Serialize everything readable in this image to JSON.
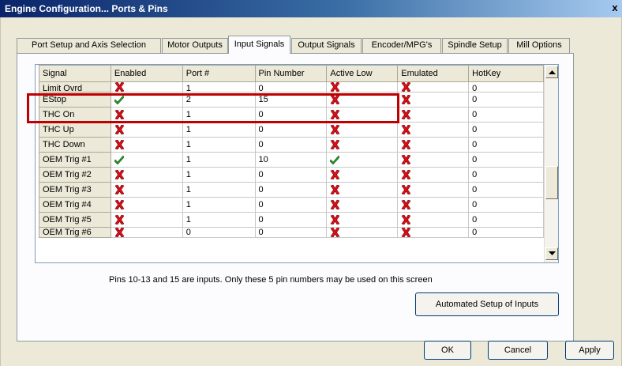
{
  "window": {
    "title": "Engine Configuration... Ports & Pins",
    "close_label": "x"
  },
  "tabs": [
    {
      "label": "Port Setup and Axis Selection",
      "active": false
    },
    {
      "label": "Motor Outputs",
      "active": false
    },
    {
      "label": "Input Signals",
      "active": true
    },
    {
      "label": "Output Signals",
      "active": false
    },
    {
      "label": "Encoder/MPG's",
      "active": false
    },
    {
      "label": "Spindle Setup",
      "active": false
    },
    {
      "label": "Mill Options",
      "active": false
    }
  ],
  "grid": {
    "columns": [
      "Signal",
      "Enabled",
      "Port #",
      "Pin Number",
      "Active Low",
      "Emulated",
      "HotKey"
    ],
    "rows": [
      {
        "signal": "Limit Ovrd",
        "enabled": "cross",
        "port": "1",
        "pin": "0",
        "active_low": "cross",
        "emulated": "cross",
        "hotkey": "0"
      },
      {
        "signal": "EStop",
        "enabled": "check",
        "port": "2",
        "pin": "15",
        "active_low": "cross",
        "emulated": "cross",
        "hotkey": "0"
      },
      {
        "signal": "THC On",
        "enabled": "cross",
        "port": "1",
        "pin": "0",
        "active_low": "cross",
        "emulated": "cross",
        "hotkey": "0"
      },
      {
        "signal": "THC Up",
        "enabled": "cross",
        "port": "1",
        "pin": "0",
        "active_low": "cross",
        "emulated": "cross",
        "hotkey": "0"
      },
      {
        "signal": "THC Down",
        "enabled": "cross",
        "port": "1",
        "pin": "0",
        "active_low": "cross",
        "emulated": "cross",
        "hotkey": "0"
      },
      {
        "signal": "OEM Trig #1",
        "enabled": "check",
        "port": "1",
        "pin": "10",
        "active_low": "check",
        "emulated": "cross",
        "hotkey": "0"
      },
      {
        "signal": "OEM Trig #2",
        "enabled": "cross",
        "port": "1",
        "pin": "0",
        "active_low": "cross",
        "emulated": "cross",
        "hotkey": "0"
      },
      {
        "signal": "OEM Trig #3",
        "enabled": "cross",
        "port": "1",
        "pin": "0",
        "active_low": "cross",
        "emulated": "cross",
        "hotkey": "0"
      },
      {
        "signal": "OEM Trig #4",
        "enabled": "cross",
        "port": "1",
        "pin": "0",
        "active_low": "cross",
        "emulated": "cross",
        "hotkey": "0"
      },
      {
        "signal": "OEM Trig #5",
        "enabled": "cross",
        "port": "1",
        "pin": "0",
        "active_low": "cross",
        "emulated": "cross",
        "hotkey": "0"
      },
      {
        "signal": "OEM Trig #6",
        "enabled": "cross",
        "port": "0",
        "pin": "0",
        "active_low": "cross",
        "emulated": "cross",
        "hotkey": "0"
      }
    ]
  },
  "icons": {
    "cross": "red-x-icon",
    "check": "green-check-icon"
  },
  "colors": {
    "cross": "#d8101a",
    "check": "#2e9a2e",
    "highlight": "#c00000"
  },
  "note": "Pins 10-13 and 15 are inputs. Only these 5 pin numbers may be used on this screen",
  "buttons": {
    "automated_setup": "Automated Setup of Inputs",
    "ok": "OK",
    "cancel": "Cancel",
    "apply": "Apply"
  }
}
